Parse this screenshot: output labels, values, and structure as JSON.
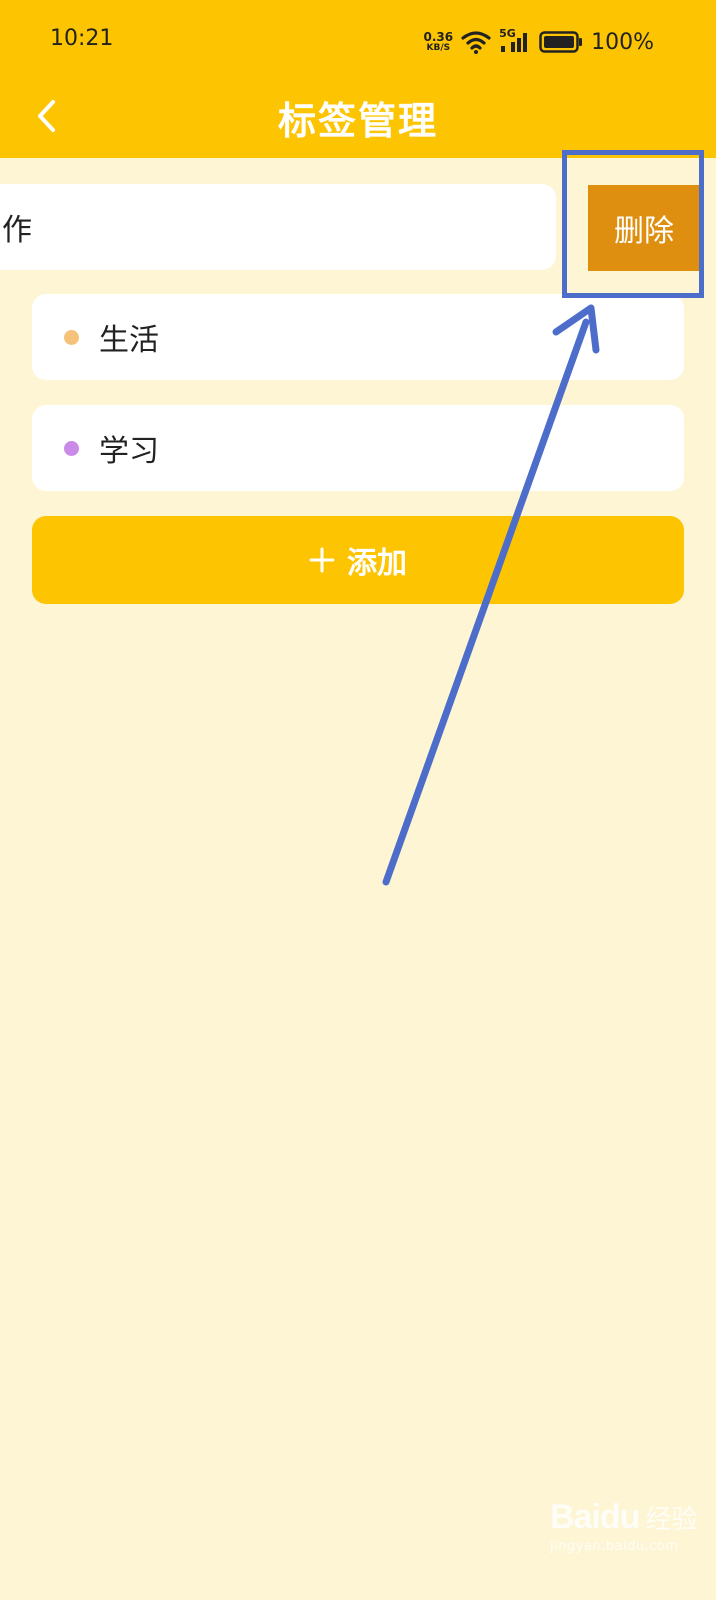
{
  "status_bar": {
    "time": "10:21",
    "net_speed_value": "0.36",
    "net_speed_unit": "KB/S",
    "network_type": "5G",
    "battery": "100%"
  },
  "header": {
    "title": "标签管理",
    "back_icon": "chevron-left-icon"
  },
  "tags": [
    {
      "label": "作",
      "swiped": true
    },
    {
      "label": "生活",
      "dot_color": "#F6C27A"
    },
    {
      "label": "学习",
      "dot_color": "#C98AE8"
    }
  ],
  "actions": {
    "delete_label": "删除",
    "add_label": "添加",
    "add_icon": "plus-icon"
  },
  "watermark": {
    "logo": "Baidu",
    "cn": "经验",
    "url": "jingyan.baidu.com"
  },
  "colors": {
    "header": "#FDC402",
    "background": "#FDF5D4",
    "delete": "#DE8F0F",
    "annotation": "#4C6DC9"
  }
}
